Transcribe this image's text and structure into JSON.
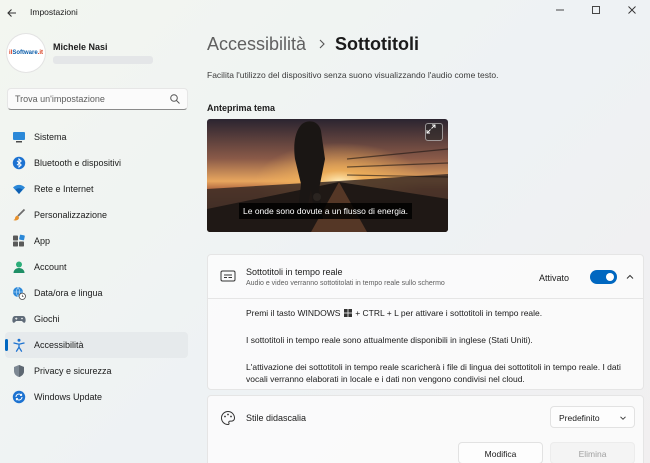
{
  "window": {
    "title": "Impostazioni",
    "back_icon": "back-arrow-icon",
    "controls": [
      "minimize-icon",
      "maximize-icon",
      "close-icon"
    ]
  },
  "profile": {
    "name": "Michele Nasi",
    "avatar_logo": {
      "prefix": "il",
      "word": "Software",
      "suffix": ".it"
    }
  },
  "search": {
    "placeholder": "Trova un'impostazione",
    "icon": "search-icon"
  },
  "sidebar": {
    "items": [
      {
        "label": "Sistema",
        "icon": "system-icon"
      },
      {
        "label": "Bluetooth e dispositivi",
        "icon": "bluetooth-icon"
      },
      {
        "label": "Rete e Internet",
        "icon": "wifi-icon"
      },
      {
        "label": "Personalizzazione",
        "icon": "brush-icon"
      },
      {
        "label": "App",
        "icon": "apps-icon"
      },
      {
        "label": "Account",
        "icon": "account-icon"
      },
      {
        "label": "Data/ora e lingua",
        "icon": "globe-clock-icon"
      },
      {
        "label": "Giochi",
        "icon": "gamepad-icon"
      },
      {
        "label": "Accessibilità",
        "icon": "accessibility-icon",
        "active": true
      },
      {
        "label": "Privacy e sicurezza",
        "icon": "shield-icon"
      },
      {
        "label": "Windows Update",
        "icon": "update-icon"
      }
    ]
  },
  "page": {
    "breadcrumb_parent": "Accessibilità",
    "breadcrumb_current": "Sottotitoli",
    "description": "Facilita l'utilizzo del dispositivo senza suono visualizzando l'audio come testo."
  },
  "preview": {
    "heading": "Anteprima tema",
    "caption": "Le onde sono dovute a un flusso di energia."
  },
  "live_captions": {
    "title": "Sottotitoli in tempo reale",
    "subtitle": "Audio e video verranno sottotitolati in tempo reale sullo schermo",
    "status": "Attivato",
    "enabled": true,
    "shortcut_pre": "Premi il tasto WINDOWS",
    "shortcut_post": "+ CTRL + L per attivare i sottotitoli in tempo reale.",
    "availability": "I sottotitoli in tempo reale sono attualmente disponibili in inglese (Stati Uniti).",
    "download_note": "L'attivazione dei sottotitoli in tempo reale scaricherà i file di lingua dei sottotitoli in tempo reale. I dati vocali verranno elaborati in locale e i dati non vengono condivisi nel cloud."
  },
  "caption_style": {
    "title": "Stile didascalia",
    "selected": "Predefinito",
    "edit_label": "Modifica",
    "delete_label": "Elimina"
  },
  "colors": {
    "accent": "#0067c0",
    "active_nav_bg": "#e6eaec"
  }
}
